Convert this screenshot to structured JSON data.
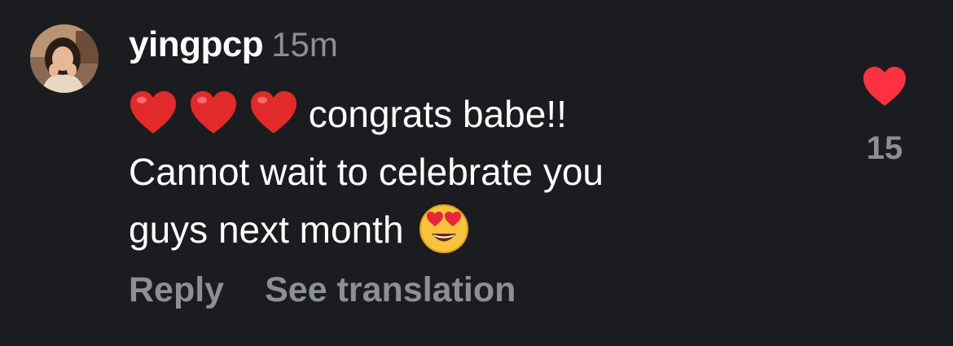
{
  "comment": {
    "username": "yingpcp",
    "timestamp": "15m",
    "lines": [
      " congrats babe!!",
      "Cannot wait to celebrate you",
      "guys next month"
    ],
    "leading_emojis": [
      "red-heart",
      "red-heart",
      "red-heart"
    ],
    "trailing_emoji": "heart-eyes",
    "actions": {
      "reply_label": "Reply",
      "translate_label": "See translation"
    },
    "like": {
      "count": "15",
      "liked": true,
      "color": "#ff3040"
    }
  },
  "colors": {
    "background": "#1b1c20",
    "text": "#ffffff",
    "muted": "#8d8f96"
  }
}
